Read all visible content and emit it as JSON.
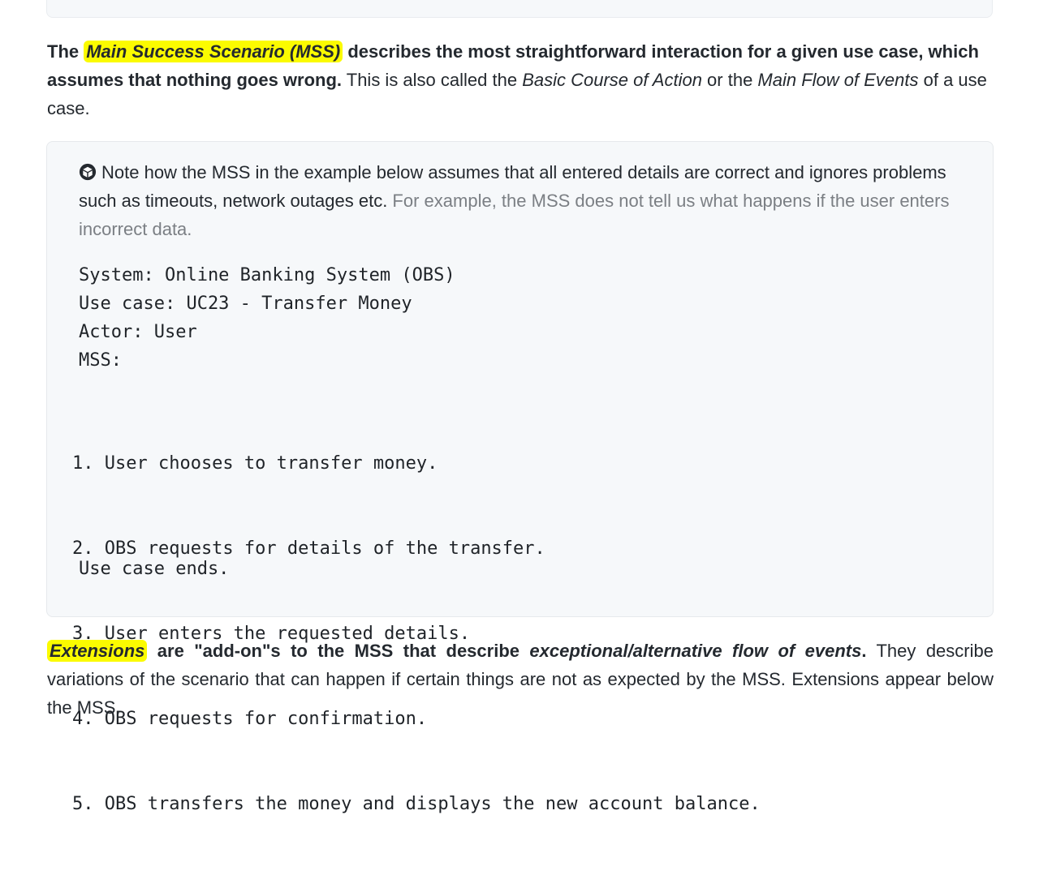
{
  "mss_paragraph": {
    "lead": "The ",
    "highlight": "Main Success Scenario (MSS)",
    "bold_rest": " describes the most straightforward interaction for a given use case, which assumes that nothing goes wrong.",
    "t1": " This is also called the ",
    "i1": "Basic Course of Action",
    "t2": " or the ",
    "i2": "Main Flow of Events",
    "t3": " of a use case."
  },
  "example_box": {
    "icon": "cube-icon",
    "note_main": "Note how the MSS in the example below assumes that all entered details are correct and ignores problems such as timeouts, network outages etc.",
    "note_muted": " For example, the MSS does not tell us what happens if the user enters incorrect data.",
    "header_lines": [
      "System: Online Banking System (OBS)",
      "Use case: UC23 - Transfer Money",
      "Actor: User",
      "MSS:"
    ],
    "steps": [
      "1. User chooses to transfer money.",
      "2. OBS requests for details of the transfer.",
      "3. User enters the requested details.",
      "4. OBS requests for confirmation.",
      "5. OBS transfers the money and displays the new account balance."
    ],
    "ending": "Use case ends."
  },
  "extensions_paragraph": {
    "highlight": "Extensions",
    "bold1": " are \"add-on\"s to the MSS that describe ",
    "bold_italic": "exceptional/alternative flow of events",
    "bold2": ".",
    "rest": " They describe variations of the scenario that can happen if certain things are not as expected by the MSS. Extensions appear below the MSS."
  }
}
